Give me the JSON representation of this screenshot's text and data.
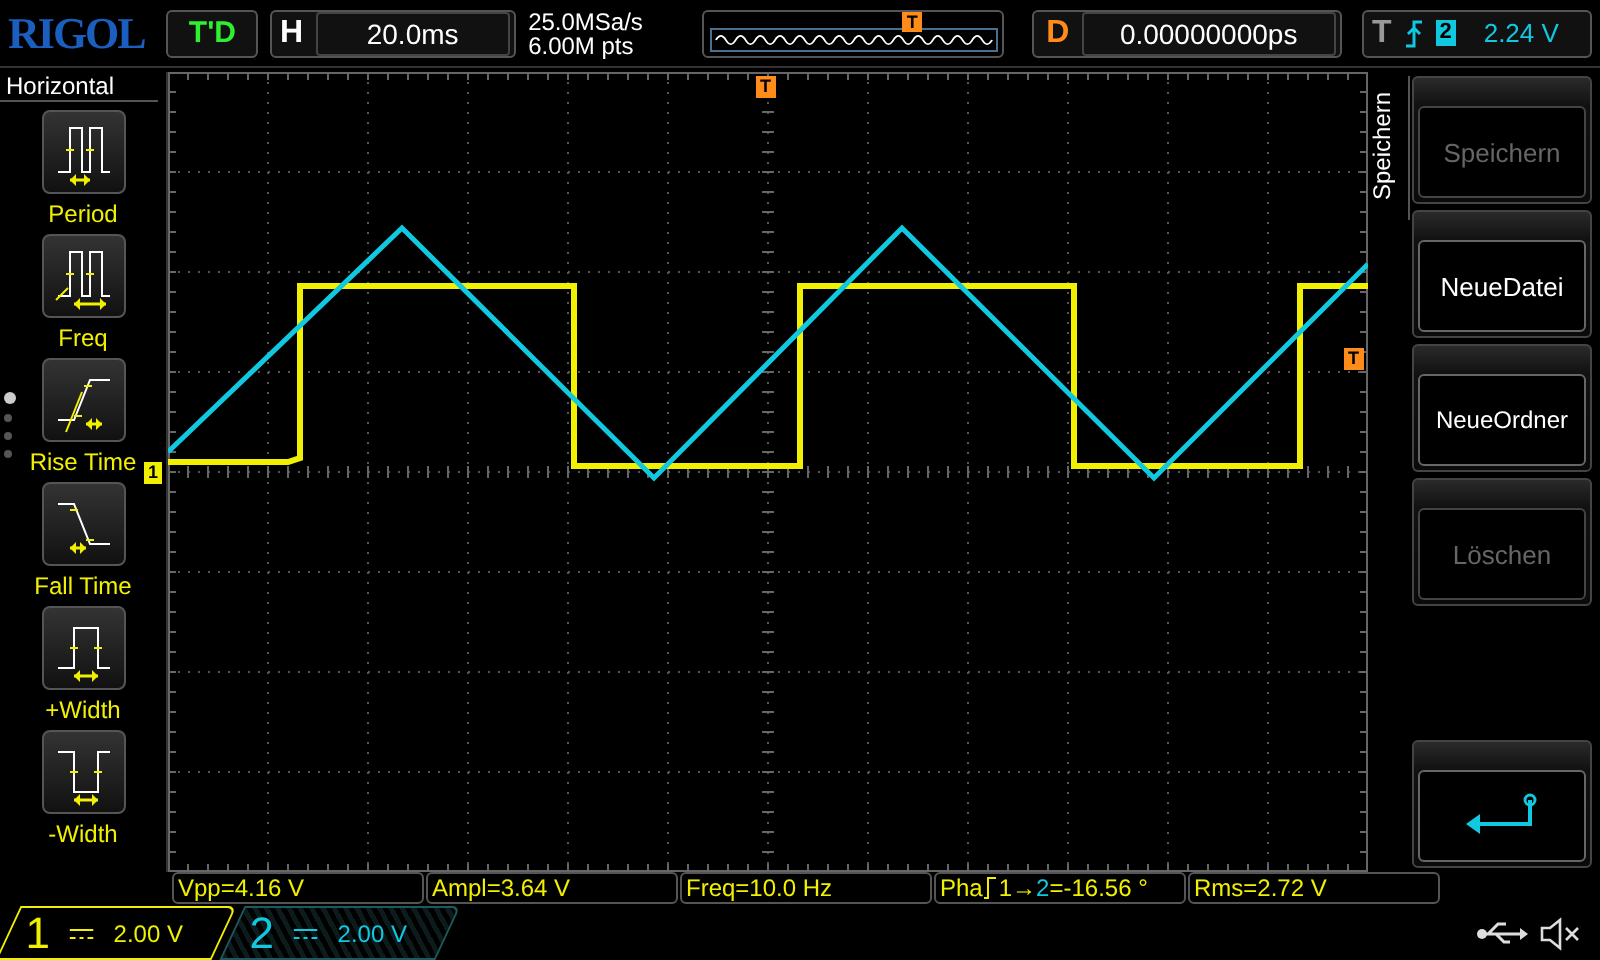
{
  "header": {
    "brand": "RIGOL",
    "run_status": "T'D",
    "timebase": {
      "label": "H",
      "value": "20.0ms"
    },
    "sample_rate": "25.0MSa/s",
    "memory_depth": "6.00M pts",
    "overview_marker": "T",
    "delay": {
      "label": "D",
      "value": "0.00000000ps"
    },
    "trigger": {
      "label": "T",
      "source": "2",
      "level": "2.24 V"
    }
  },
  "left_menu": {
    "title": "Horizontal",
    "items": [
      {
        "kind": "period",
        "label": "Period"
      },
      {
        "kind": "freq",
        "label": "Freq"
      },
      {
        "kind": "rise",
        "label": "Rise Time"
      },
      {
        "kind": "fall",
        "label": "Fall Time"
      },
      {
        "kind": "pwidth",
        "label": "+Width"
      },
      {
        "kind": "nwidth",
        "label": "-Width"
      }
    ],
    "pages": [
      {
        "selected": true
      },
      {
        "selected": false
      },
      {
        "selected": false
      },
      {
        "selected": false
      }
    ]
  },
  "screen": {
    "channel_marker": "1",
    "trigger_position_marker": "T",
    "trigger_level_marker": "T"
  },
  "right_menu": {
    "title": "Speichern",
    "buttons": [
      {
        "kind": "text",
        "label": "Speichern",
        "disabled": true
      },
      {
        "kind": "text",
        "label": "NeueDatei",
        "disabled": false
      },
      {
        "kind": "text",
        "label": "NeueOrdner",
        "disabled": false
      },
      {
        "kind": "text",
        "label": "Löschen",
        "disabled": true
      },
      {
        "kind": "return"
      }
    ]
  },
  "measurements": [
    {
      "kind": "value",
      "text": "Vpp=4.16 V"
    },
    {
      "kind": "value",
      "text": "Ampl=3.64 V"
    },
    {
      "kind": "value",
      "text": "Freq=10.0 Hz"
    },
    {
      "kind": "phase",
      "label": "Pha",
      "from": "1",
      "arrow": "→",
      "to": "2",
      "value": "=-16.56 °"
    },
    {
      "kind": "value",
      "text": "Rms=2.72 V"
    }
  ],
  "channels": [
    {
      "number": "1",
      "scale": "2.00 V",
      "selected": true,
      "color": "#f0f000"
    },
    {
      "number": "2",
      "scale": "2.00 V",
      "selected": false,
      "color": "#10c8e0"
    }
  ]
}
